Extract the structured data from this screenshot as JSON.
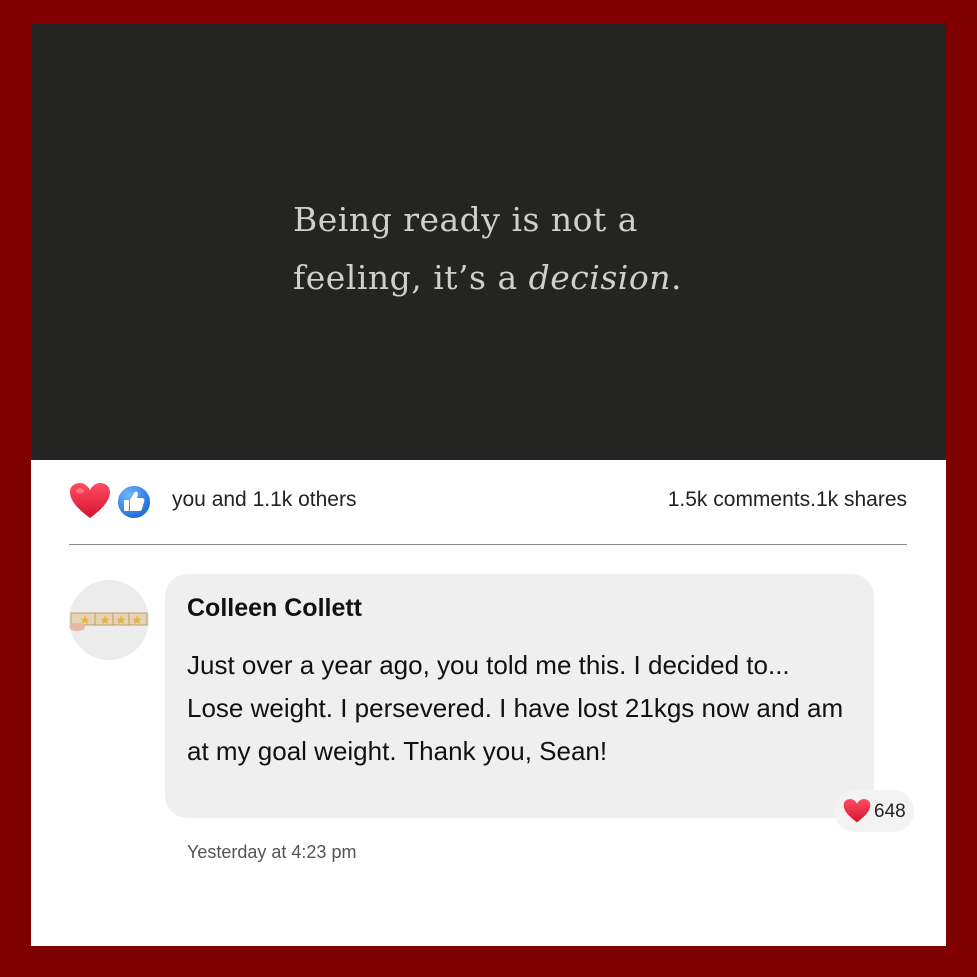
{
  "post": {
    "quote": {
      "line1": "Being ready is not a",
      "line2_plain": "feeling, it’s a ",
      "line2_italic": "decision",
      "line2_end": "."
    },
    "reactions": {
      "icons": [
        "heart-icon",
        "like-icon"
      ],
      "summary": "you and 1.1k others"
    },
    "engagement": "1.5k comments.1k shares"
  },
  "comment": {
    "author": "Colleen Collett",
    "text": "Just over a year ago, you told me this. I decided to... Lose weight. I persevered. I have lost 21kgs now and am at my goal weight. Thank you, Sean!",
    "reaction_icon": "heart-icon",
    "reaction_count": "648",
    "timestamp": "Yesterday at 4:23 pm"
  },
  "colors": {
    "frame": "#800000",
    "quote_background": "#242523",
    "heart": "#e8324a",
    "like": "#1877f2",
    "bubble": "#efefef"
  }
}
